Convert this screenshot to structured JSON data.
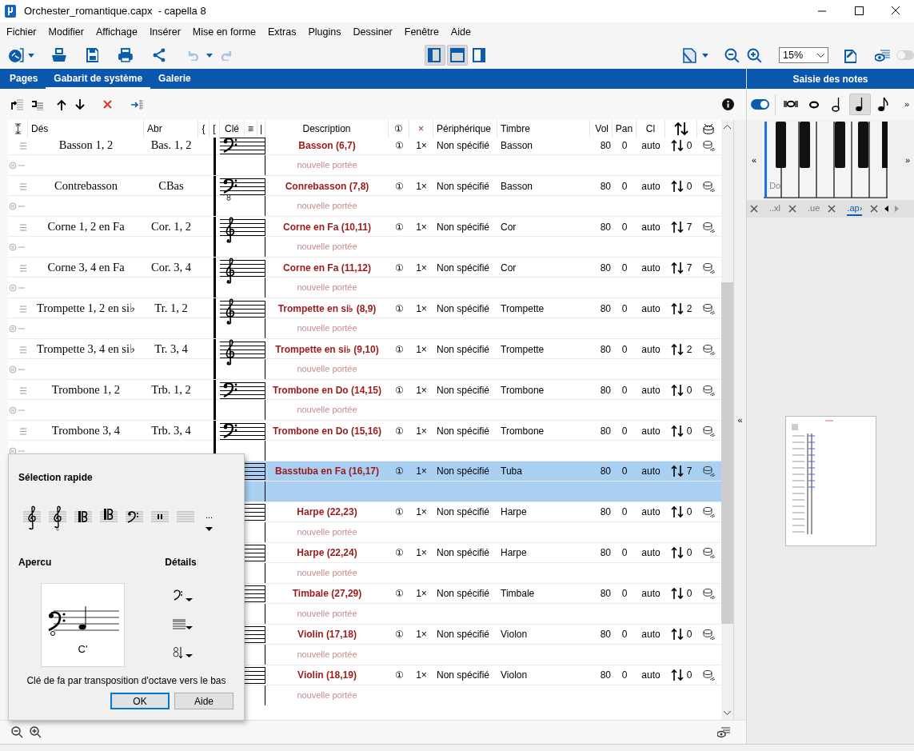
{
  "window": {
    "title": "Orchester_romantique.capx  - capella 8"
  },
  "menu": [
    "Fichier",
    "Modifier",
    "Affichage",
    "Insérer",
    "Mise en forme",
    "Extras",
    "Plugins",
    "Dessiner",
    "Fenêtre",
    "Aide"
  ],
  "toolbar": {
    "view_buttons": [
      {
        "on": true
      },
      {
        "on": true
      },
      {
        "on": false
      }
    ],
    "zoom": "15%",
    "preview_toggle": {
      "on": false
    }
  },
  "tabs": [
    {
      "label": "Pages",
      "selected": false
    },
    {
      "label": "Gabarit de système",
      "selected": true
    },
    {
      "label": "Galerie",
      "selected": false
    }
  ],
  "table": {
    "columns": [
      "Dés",
      "Abr",
      "{",
      "[",
      "Clé",
      "≡",
      "|",
      "Description",
      "①",
      "×",
      "Périphérique",
      "Timbre",
      "Vol",
      "Pan",
      "Cl"
    ],
    "rows": [
      {
        "name": "Basson 1, 2",
        "abbr": "Bas. 1, 2",
        "clef": {
          "kind": "bass"
        },
        "bracket": true,
        "description": "Basson (6,7)",
        "voices": "①",
        "count": "1×",
        "device": "Non spécifié",
        "timbre": "Basson",
        "vol": "80",
        "pan": "0",
        "cl": "auto",
        "transpose": "0",
        "new_staff": "nouvelle portée",
        "selected": false
      },
      {
        "name": "Contrebasson",
        "abbr": "CBas",
        "clef": {
          "kind": "bass8"
        },
        "bracket": true,
        "description": "Conrebasson (7,8)",
        "voices": "①",
        "count": "1×",
        "device": "Non spécifié",
        "timbre": "Basson",
        "vol": "80",
        "pan": "0",
        "cl": "auto",
        "transpose": "0",
        "new_staff": "nouvelle portée",
        "selected": false
      },
      {
        "name": "Corne 1, 2 en Fa",
        "abbr": "Cor. 1, 2",
        "clef": {
          "kind": "treble"
        },
        "bracket": true,
        "description": "Corne en Fa (10,11)",
        "voices": "①",
        "count": "1×",
        "device": "Non spécifié",
        "timbre": "Cor",
        "vol": "80",
        "pan": "0",
        "cl": "auto",
        "transpose": "7",
        "new_staff": "nouvelle portée",
        "selected": false
      },
      {
        "name": "Corne 3, 4 en Fa",
        "abbr": "Cor. 3, 4",
        "clef": {
          "kind": "treble"
        },
        "bracket": true,
        "description": "Corne en Fa (11,12)",
        "voices": "①",
        "count": "1×",
        "device": "Non spécifié",
        "timbre": "Cor",
        "vol": "80",
        "pan": "0",
        "cl": "auto",
        "transpose": "7",
        "new_staff": "nouvelle portée",
        "selected": false
      },
      {
        "name": "Trompette 1, 2 en si♭",
        "abbr": "Tr. 1, 2",
        "clef": {
          "kind": "treble"
        },
        "bracket": true,
        "description": "Trompette en si♭ (8,9)",
        "voices": "①",
        "count": "1×",
        "device": "Non spécifié",
        "timbre": "Trompette",
        "vol": "80",
        "pan": "0",
        "cl": "auto",
        "transpose": "2",
        "new_staff": "nouvelle portée",
        "selected": false
      },
      {
        "name": "Trompette 3, 4 en si♭",
        "abbr": "Tr. 3, 4",
        "clef": {
          "kind": "treble"
        },
        "bracket": true,
        "description": "Trompette en si♭ (9,10)",
        "voices": "①",
        "count": "1×",
        "device": "Non spécifié",
        "timbre": "Trompette",
        "vol": "80",
        "pan": "0",
        "cl": "auto",
        "transpose": "2",
        "new_staff": "nouvelle portée",
        "selected": false
      },
      {
        "name": "Trombone 1, 2",
        "abbr": "Trb. 1, 2",
        "clef": {
          "kind": "bass"
        },
        "bracket": true,
        "description": "Trombone en Do (14,15)",
        "voices": "①",
        "count": "1×",
        "device": "Non spécifié",
        "timbre": "Trombone",
        "vol": "80",
        "pan": "0",
        "cl": "auto",
        "transpose": "0",
        "new_staff": "nouvelle portée",
        "selected": false
      },
      {
        "name": "Trombone 3, 4",
        "abbr": "Trb. 3, 4",
        "clef": {
          "kind": "bass"
        },
        "bracket": true,
        "description": "Trombone en Do (15,16)",
        "voices": "①",
        "count": "1×",
        "device": "Non spécifié",
        "timbre": "Trombone",
        "vol": "80",
        "pan": "0",
        "cl": "auto",
        "transpose": "0",
        "selected": false
      },
      {
        "description": "Basstuba en Fa (16,17)",
        "voices": "①",
        "count": "1×",
        "device": "Non spécifié",
        "timbre": "Tuba",
        "vol": "80",
        "pan": "0",
        "cl": "auto",
        "transpose": "7",
        "selected": true
      },
      {
        "description": "Harpe (22,23)",
        "voices": "①",
        "count": "1×",
        "device": "Non spécifié",
        "timbre": "Harpe",
        "vol": "80",
        "pan": "0",
        "cl": "auto",
        "transpose": "0",
        "new_staff": "nouvelle portée",
        "selected": false
      },
      {
        "description": "Harpe (22,24)",
        "voices": "①",
        "count": "1×",
        "device": "Non spécifié",
        "timbre": "Harpe",
        "vol": "80",
        "pan": "0",
        "cl": "auto",
        "transpose": "0",
        "new_staff": "nouvelle portée",
        "selected": false
      },
      {
        "description": "Timbale (27,29)",
        "voices": "①",
        "count": "1×",
        "device": "Non spécifié",
        "timbre": "Timbale",
        "vol": "80",
        "pan": "0",
        "cl": "auto",
        "transpose": "0",
        "new_staff": "nouvelle portée",
        "selected": false
      },
      {
        "description": "Violin (17,18)",
        "voices": "①",
        "count": "1×",
        "device": "Non spécifié",
        "timbre": "Violon",
        "vol": "80",
        "pan": "0",
        "cl": "auto",
        "transpose": "0",
        "new_staff": "nouvelle portée",
        "selected": false
      },
      {
        "description": "Violin (18,19)",
        "voices": "①",
        "count": "1×",
        "device": "Non spécifié",
        "timbre": "Violon",
        "vol": "80",
        "pan": "0",
        "cl": "auto",
        "transpose": "0",
        "new_staff": "nouvelle portée",
        "selected": false
      }
    ]
  },
  "side_toggle": "«",
  "dialog": {
    "quick_title": "Sélection rapide",
    "more": "...",
    "preview_title": "Apercu",
    "details_title": "Détails",
    "preview_note": "C'",
    "caption": "Clé de fa par transposition d'octave vers le bas",
    "buttons": [
      {
        "label": "OK",
        "default": true
      },
      {
        "label": "Aide",
        "default": false
      }
    ]
  },
  "panel": {
    "title": "Saisie des notes",
    "input_toggle": {
      "on": true
    },
    "durations": [
      {
        "kind": "breve",
        "selected": false
      },
      {
        "kind": "whole",
        "selected": false
      },
      {
        "kind": "half",
        "selected": false
      },
      {
        "kind": "quarter",
        "selected": true
      },
      {
        "kind": "eighth",
        "selected": false
      }
    ],
    "more": "»",
    "scroll_left": "«",
    "scroll_right": "»",
    "key_label": "Do",
    "file_tabs": [
      {
        "label": "..xl",
        "selected": false
      },
      {
        "label": ".ue",
        "selected": false
      },
      {
        "label": ".ap›",
        "selected": true
      }
    ]
  }
}
